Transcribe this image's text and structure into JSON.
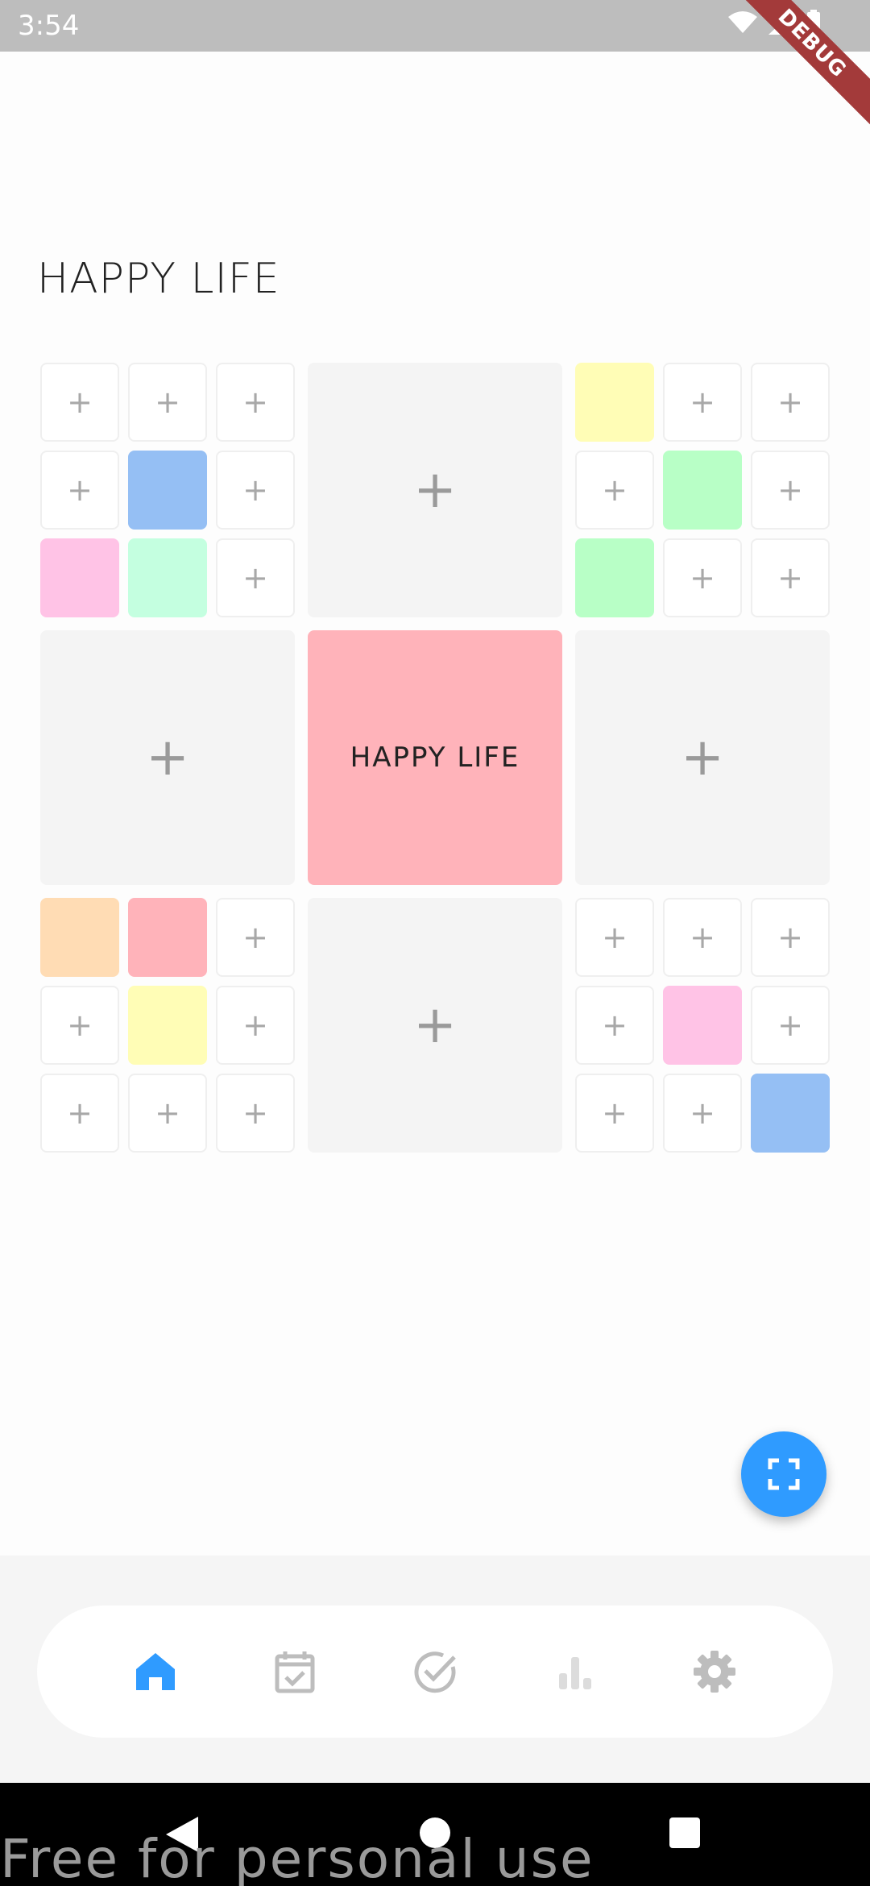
{
  "status_bar": {
    "time": "3:54",
    "debug_label": "DEBUG"
  },
  "page": {
    "title": "HAPPY LIFE"
  },
  "grid": {
    "add_symbol": "+",
    "center_label": "HAPPY LIFE",
    "colors": {
      "yellow": "#fffdb6",
      "blue": "#95bff4",
      "green": "#b8ffc6",
      "mint": "#c4ffe0",
      "pink": "#ffc3e6",
      "peach": "#ffdcb4",
      "salmon": "#ffb3ba",
      "center": "#ffb3ba",
      "empty_big": "#f4f4f4"
    }
  },
  "bottom_nav": {
    "items": [
      {
        "name": "home",
        "icon": "home-icon",
        "active": true
      },
      {
        "name": "calendar",
        "icon": "calendar-check-icon",
        "active": false
      },
      {
        "name": "check",
        "icon": "check-circle-icon",
        "active": false
      },
      {
        "name": "stats",
        "icon": "bar-chart-icon",
        "active": false
      },
      {
        "name": "settings",
        "icon": "gear-icon",
        "active": false
      }
    ],
    "active_color": "#2f9bff",
    "inactive_color": "#bdbdbd"
  },
  "fab": {
    "icon": "fullscreen-icon",
    "color": "#2f9bff"
  },
  "watermark": {
    "text": "Free for personal use"
  }
}
